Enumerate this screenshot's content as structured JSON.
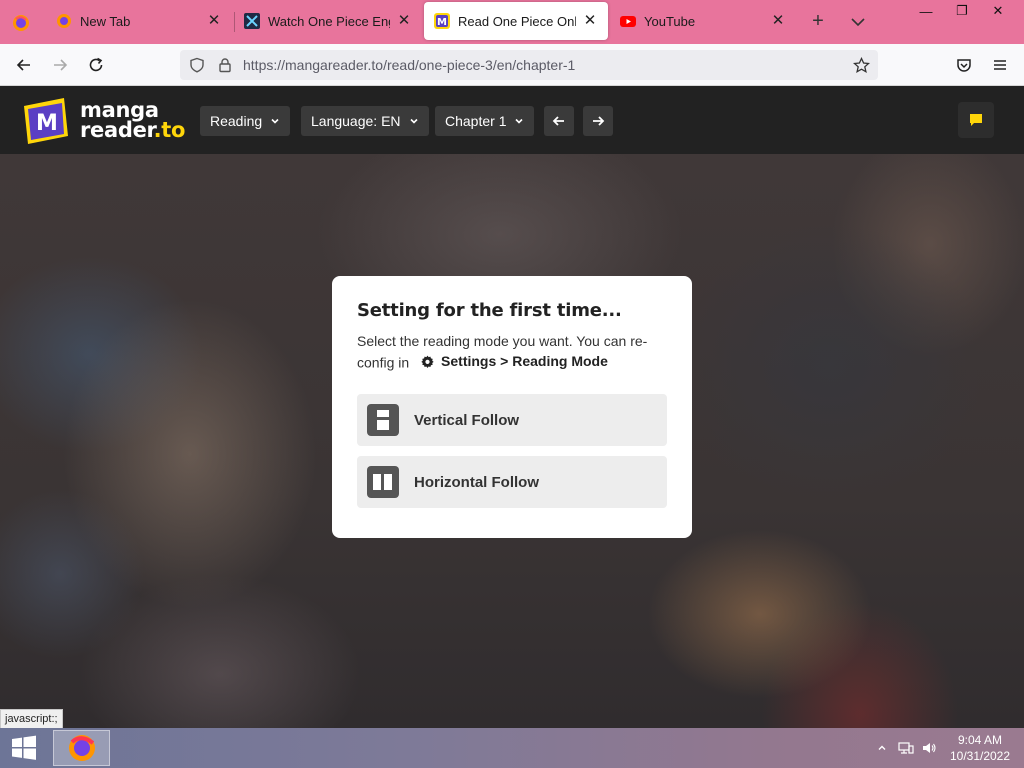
{
  "browser": {
    "tabs": [
      {
        "title": "New Tab",
        "icon": "firefox-icon",
        "active": false
      },
      {
        "title": "Watch One Piece English",
        "icon": "site-favicon",
        "active": false
      },
      {
        "title": "Read One Piece Online F",
        "icon": "mangareader-favicon",
        "active": true
      },
      {
        "title": "YouTube",
        "icon": "youtube-icon",
        "active": false
      }
    ],
    "url": "https://mangareader.to/read/one-piece-3/en/chapter-1",
    "window_controls": {
      "minimize": "—",
      "restore": "❐",
      "close": "✕"
    }
  },
  "site": {
    "logo": {
      "badge_letter": "M",
      "line1": "manga",
      "line2": "reader",
      "tld": ".to"
    },
    "header": {
      "reading_label": "Reading",
      "language_label": "Language: EN",
      "chapter_label": "Chapter 1"
    },
    "accent": "#ffd60a"
  },
  "modal": {
    "title": "Setting for the first time...",
    "description": "Select the reading mode you want. You can re-config in",
    "settings_path": "Settings > Reading Mode",
    "options": [
      {
        "label": "Vertical Follow",
        "icon": "vertical-mode-icon"
      },
      {
        "label": "Horizontal Follow",
        "icon": "horizontal-mode-icon"
      }
    ]
  },
  "status_tooltip": "javascript:;",
  "taskbar": {
    "time": "9:04 AM",
    "date": "10/31/2022"
  }
}
